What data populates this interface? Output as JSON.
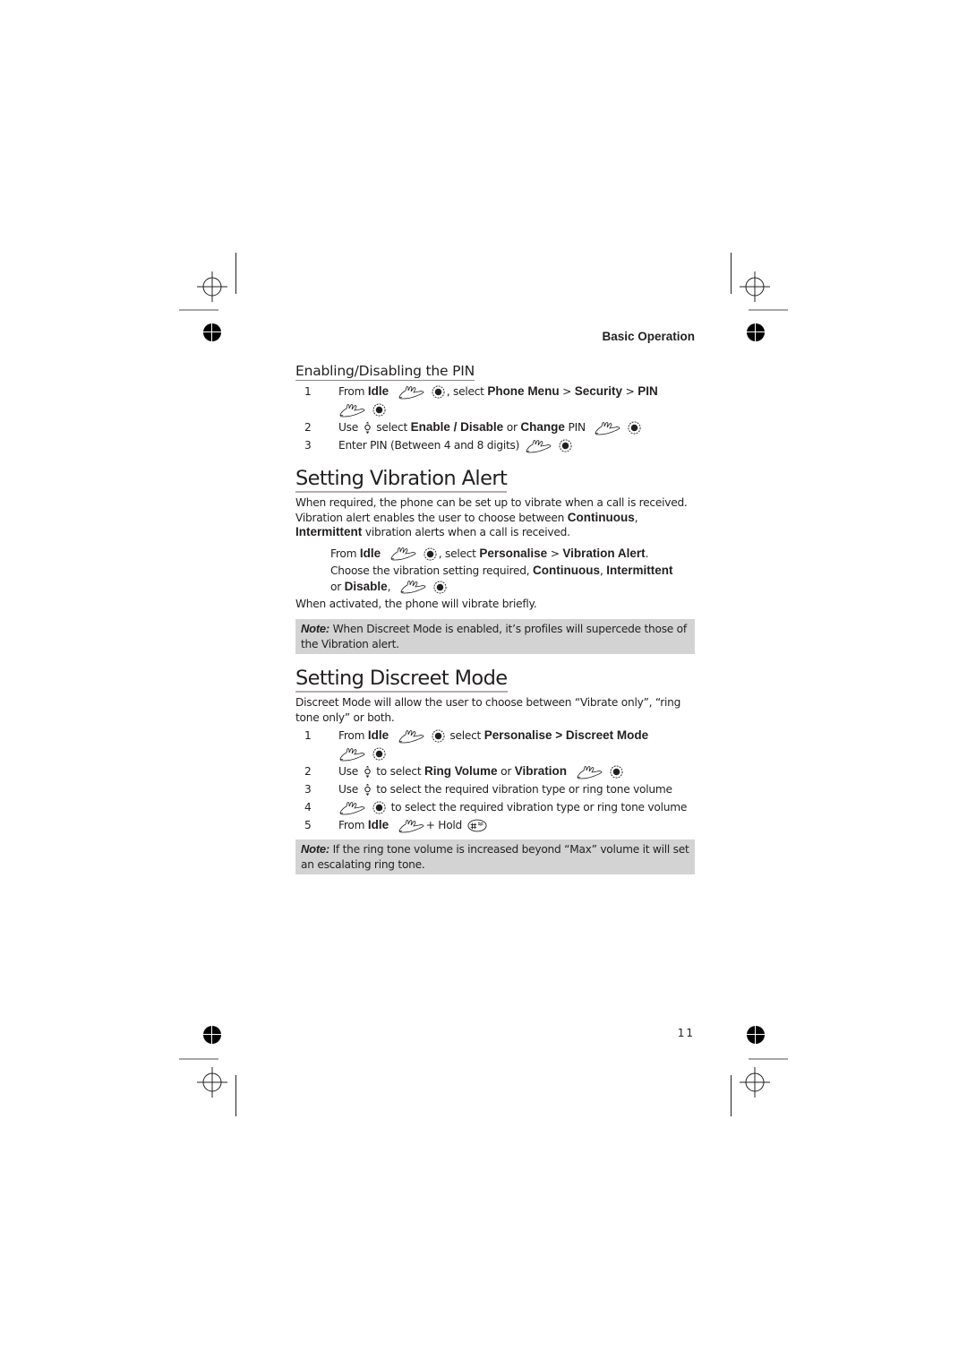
{
  "running_head": "Basic Operation",
  "page_number": "11",
  "icons": {
    "soft_key": "soft-key-hand-icon",
    "ok_key": "ok-select-key-icon",
    "nav_key": "navigation-key-icon",
    "hash_key": "hash-key-icon"
  },
  "colors": {
    "text": "#231f20",
    "note_background": "#d3d3d3",
    "heading_rule": "#b6a9b2"
  },
  "pin_section": {
    "title": "Enabling/Disabling the PIN",
    "steps": [
      {
        "num": "1",
        "t1": "From ",
        "b1": "Idle",
        "t2": ", select ",
        "b2": "Phone Menu",
        "t3": " > ",
        "b3": "Security",
        "t4": " > ",
        "b4": "PIN"
      },
      {
        "num": "2",
        "t1": "Use ",
        "t2": " select ",
        "b1": "Enable / Disable",
        "t3": " or ",
        "b2": "Change",
        "t4": " PIN"
      },
      {
        "num": "3",
        "t1": "Enter PIN (Between 4 and 8 digits)"
      }
    ]
  },
  "vibration_section": {
    "title": "Setting Vibration Alert",
    "intro": {
      "t1": "When required, the phone can be set up to vibrate when a call is received. Vibration alert enables the user to choose between ",
      "b1": "Continuous",
      "t2": ", ",
      "b2": "Intermittent",
      "t3": " vibration alerts when a call is received."
    },
    "instruction1": {
      "t1": "From ",
      "b1": "Idle",
      "t2": ", select ",
      "b2": "Personalise",
      "t3": " > ",
      "b3": "Vibration Alert",
      "t4": "."
    },
    "instruction2": {
      "t1": "Choose the vibration setting required, ",
      "b1": "Continuous",
      "t2": ", ",
      "b2": "Intermittent",
      "t3": " or ",
      "b3": "Disable",
      "t4": ","
    },
    "after": "When activated, the phone will vibrate briefly.",
    "note": {
      "label": "Note:",
      "text": " When Discreet Mode is enabled, it’s profiles will supercede those of the Vibration alert."
    }
  },
  "discreet_section": {
    "title": "Setting Discreet Mode",
    "intro": "Discreet Mode will allow the user to choose between “Vibrate only”, “ring tone only” or both.",
    "steps": [
      {
        "num": "1",
        "t1": "From ",
        "b1": "Idle",
        "t2": " select ",
        "b2": "Personalise > Discreet Mode"
      },
      {
        "num": "2",
        "t1": "Use ",
        "t2": " to select ",
        "b1": "Ring Volume",
        "t3": " or ",
        "b2": "Vibration"
      },
      {
        "num": "3",
        "t1": "Use ",
        "t2": " to select the required vibration type or ring tone volume"
      },
      {
        "num": "4",
        "t1": " to select the required vibration type or ring tone volume"
      },
      {
        "num": "5",
        "t1": "From ",
        "b1": "Idle",
        "t2": "+ Hold"
      }
    ],
    "note": {
      "label": "Note:",
      "text": " If the ring tone volume is increased beyond “Max” volume it will set an escalating ring tone."
    }
  }
}
